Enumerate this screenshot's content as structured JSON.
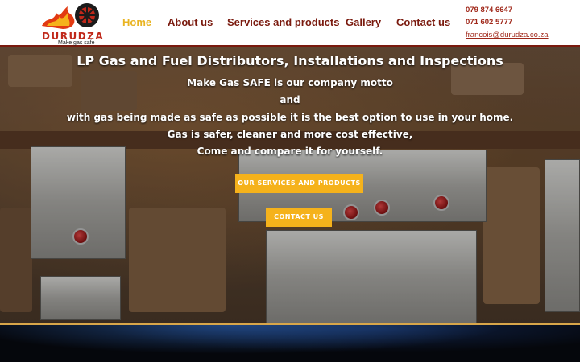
{
  "brand": {
    "name": "DURUDZA",
    "tagline": "Make gas safe"
  },
  "nav": {
    "items": [
      {
        "label": "Home",
        "active": true
      },
      {
        "label": "About us",
        "active": false
      },
      {
        "label": "Services and products",
        "active": false
      },
      {
        "label": "Gallery",
        "active": false
      },
      {
        "label": "Contact us",
        "active": false
      }
    ]
  },
  "contact": {
    "phone1": "079 874 6647",
    "phone2": "071 602 5777",
    "email": "francois@durudza.co.za"
  },
  "hero": {
    "title": "LP Gas and Fuel Distributors, Installations and Inspections",
    "lines": [
      "Make Gas SAFE is our company motto",
      "and",
      "with gas being made as safe as possible it is the best option to use in your home.",
      "Gas is safer, cleaner and more cost effective,",
      "Come and compare it for yourself."
    ],
    "buttons": {
      "services": "OUR SERVICES AND PRODUCTS",
      "contact": "CONTACT US"
    }
  },
  "colors": {
    "brand_red": "#7a1a0e",
    "accent_yellow": "#f5b21b",
    "active_nav": "#e9b422"
  }
}
